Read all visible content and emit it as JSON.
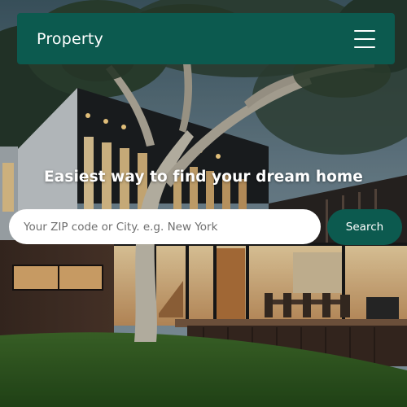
{
  "header": {
    "brand": "Property",
    "menu_icon": "hamburger-menu-icon"
  },
  "hero": {
    "headline": "Easiest way to find your dream home"
  },
  "search": {
    "placeholder": "Your ZIP code or City. e.g. New York",
    "value": "",
    "button_label": "Search"
  },
  "colors": {
    "accent": "#0c5a4f",
    "text_light": "#ffffff"
  }
}
